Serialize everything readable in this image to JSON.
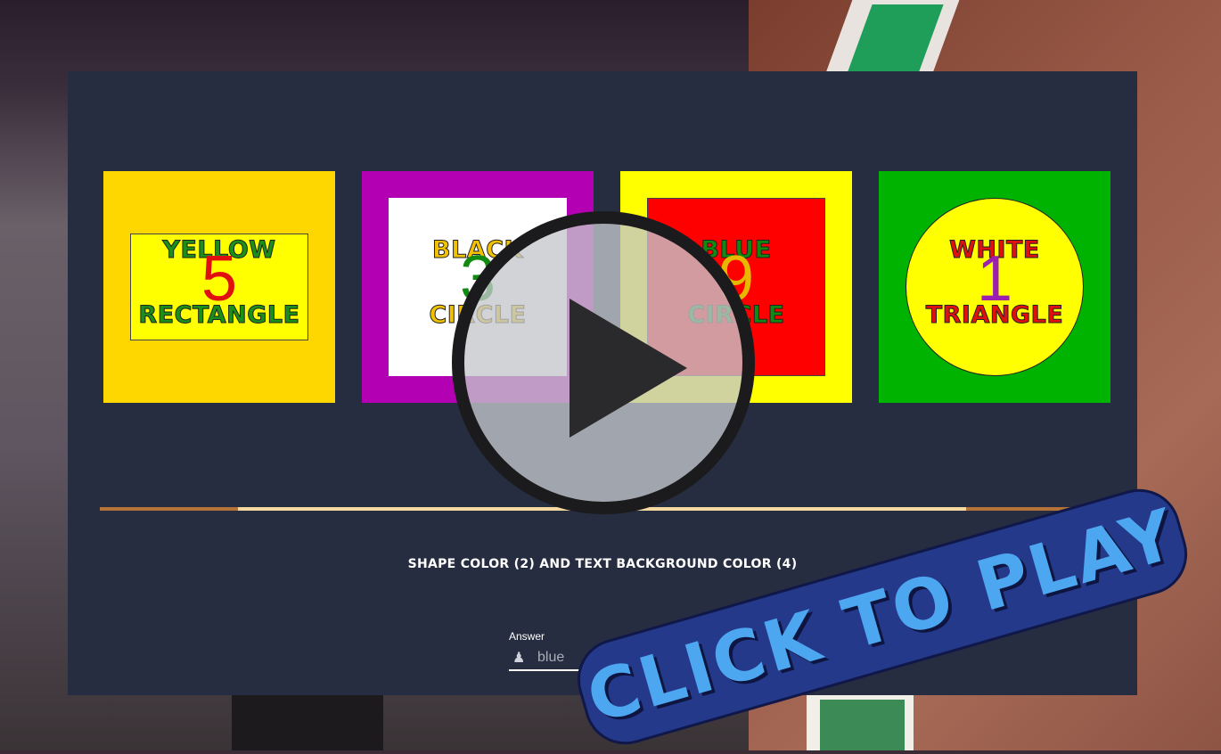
{
  "cards": [
    {
      "top_word": "YELLOW",
      "number": "5",
      "bottom_word": "RECTANGLE",
      "background_color": "#ffd700",
      "shape": "rectangle",
      "shape_color": "#ffff00"
    },
    {
      "top_word": "BLACK",
      "number": "3",
      "bottom_word": "CIRCLE",
      "background_color": "#b300b3",
      "shape": "square",
      "shape_color": "#ffffff"
    },
    {
      "top_word": "BLUE",
      "number": "9",
      "bottom_word": "CIRCLE",
      "background_color": "#ffff00",
      "shape": "square",
      "shape_color": "#ff0000"
    },
    {
      "top_word": "WHITE",
      "number": "1",
      "bottom_word": "TRIANGLE",
      "background_color": "#00b300",
      "shape": "circle",
      "shape_color": "#ffff00"
    }
  ],
  "timer": {
    "progress_start": 0.137,
    "progress_end": 0.862
  },
  "question": "SHAPE COLOR (2) AND TEXT BACKGROUND COLOR (4)",
  "answer": {
    "label": "Answer",
    "placeholder": "blue ",
    "icon": "user-secret-icon"
  },
  "overlay": {
    "play_icon": "play-icon",
    "cta_label": "CLICK TO PLAY"
  }
}
